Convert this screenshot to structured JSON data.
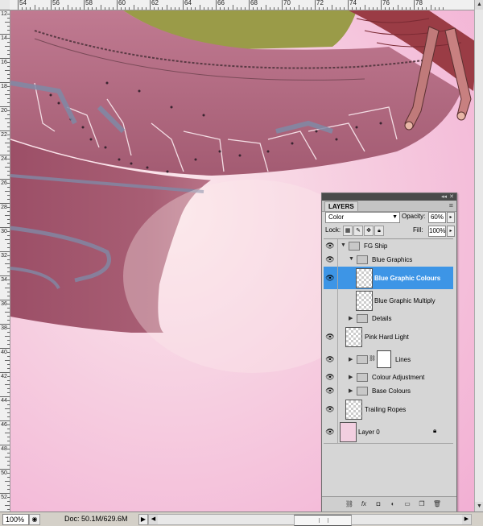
{
  "ruler_top": [
    "54",
    "56",
    "58",
    "60",
    "62",
    "64",
    "66",
    "68",
    "70",
    "72",
    "74",
    "76",
    "78"
  ],
  "ruler_left": [
    "12",
    "14",
    "16",
    "18",
    "20",
    "22",
    "24",
    "26",
    "28",
    "30",
    "32",
    "34",
    "36",
    "38",
    "40",
    "42",
    "44",
    "46",
    "48",
    "50",
    "52"
  ],
  "status": {
    "zoom": "100%",
    "doc": "Doc: 50.1M/629.6M"
  },
  "layers_panel": {
    "tab": "LAYERS",
    "blend_mode": "Color",
    "opacity_label": "Opacity:",
    "opacity_value": "60%",
    "lock_label": "Lock:",
    "fill_label": "Fill:",
    "fill_value": "100%",
    "layers": [
      {
        "name": "FG Ship",
        "type": "group",
        "expanded": true
      },
      {
        "name": "Blue Graphics",
        "type": "group",
        "expanded": true
      },
      {
        "name": "Blue Graphic Colours",
        "type": "layer",
        "selected": true
      },
      {
        "name": "Blue Graphic Multiply",
        "type": "layer"
      },
      {
        "name": "Details",
        "type": "group",
        "expanded": false
      },
      {
        "name": "Pink Hard Light",
        "type": "layer"
      },
      {
        "name": "Lines",
        "type": "group_mask",
        "expanded": false
      },
      {
        "name": "Colour Adjustment",
        "type": "group",
        "expanded": false
      },
      {
        "name": "Base Colours",
        "type": "group",
        "expanded": false
      },
      {
        "name": "Trailing Ropes",
        "type": "layer"
      },
      {
        "name": "Layer 0",
        "type": "layer",
        "locked": true
      }
    ]
  },
  "colors": {
    "canvas_pink": "#f0b8d8",
    "hull_maroon": "#9a5267",
    "hull_blue_graphic": "#7f8aa6",
    "selected_layer": "#3d95e6"
  }
}
